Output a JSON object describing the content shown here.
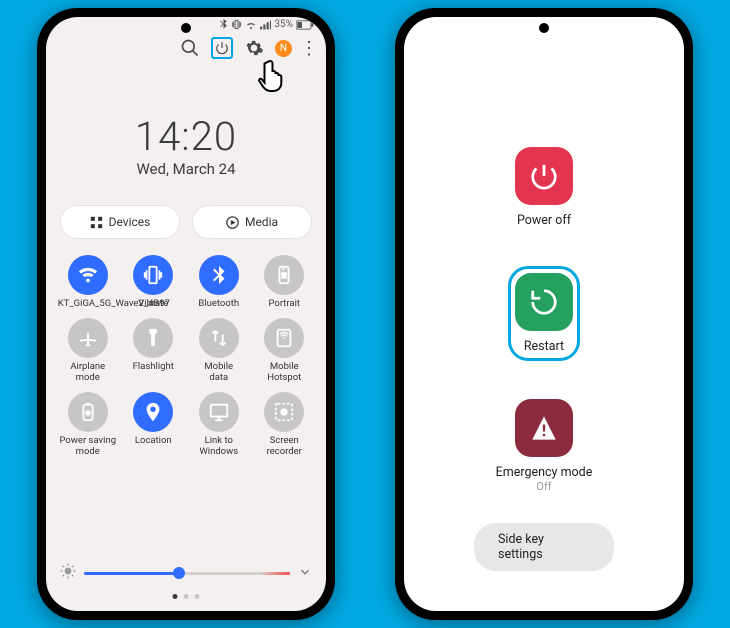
{
  "status": {
    "battery": "35%"
  },
  "clock": {
    "time": "14:20",
    "date": "Wed, March 24"
  },
  "pills": {
    "devices": "Devices",
    "media": "Media"
  },
  "qs": {
    "items": [
      {
        "name": "wifi",
        "label": "KT_GiGA_5G_Wave2_4B97",
        "on": true
      },
      {
        "name": "vibrate",
        "label": "Vibrate",
        "on": true
      },
      {
        "name": "bluetooth",
        "label": "Bluetooth",
        "on": true
      },
      {
        "name": "portrait",
        "label": "Portrait",
        "on": false
      },
      {
        "name": "airplane",
        "label": "Airplane\nmode",
        "on": false
      },
      {
        "name": "flashlight",
        "label": "Flashlight",
        "on": false
      },
      {
        "name": "mobiledata",
        "label": "Mobile\ndata",
        "on": false
      },
      {
        "name": "hotspot",
        "label": "Mobile\nHotspot",
        "on": false
      },
      {
        "name": "powersave",
        "label": "Power saving\nmode",
        "on": false
      },
      {
        "name": "location",
        "label": "Location",
        "on": true
      },
      {
        "name": "linkwin",
        "label": "Link to\nWindows",
        "on": false
      },
      {
        "name": "screenrec",
        "label": "Screen\nrecorder",
        "on": false
      }
    ]
  },
  "notif_badge": "N",
  "power_menu": {
    "power_off": "Power off",
    "restart": "Restart",
    "emergency": "Emergency mode",
    "emergency_state": "Off",
    "side_key": "Side key settings"
  },
  "icons": {
    "wifi": "wifi-icon",
    "vibrate": "vibrate-icon",
    "bluetooth": "bluetooth-icon",
    "portrait": "portrait-lock-icon",
    "airplane": "airplane-icon",
    "flashlight": "flashlight-icon",
    "mobiledata": "mobile-data-icon",
    "hotspot": "hotspot-icon",
    "powersave": "power-save-icon",
    "location": "location-icon",
    "linkwin": "link-windows-icon",
    "screenrec": "screen-recorder-icon"
  }
}
